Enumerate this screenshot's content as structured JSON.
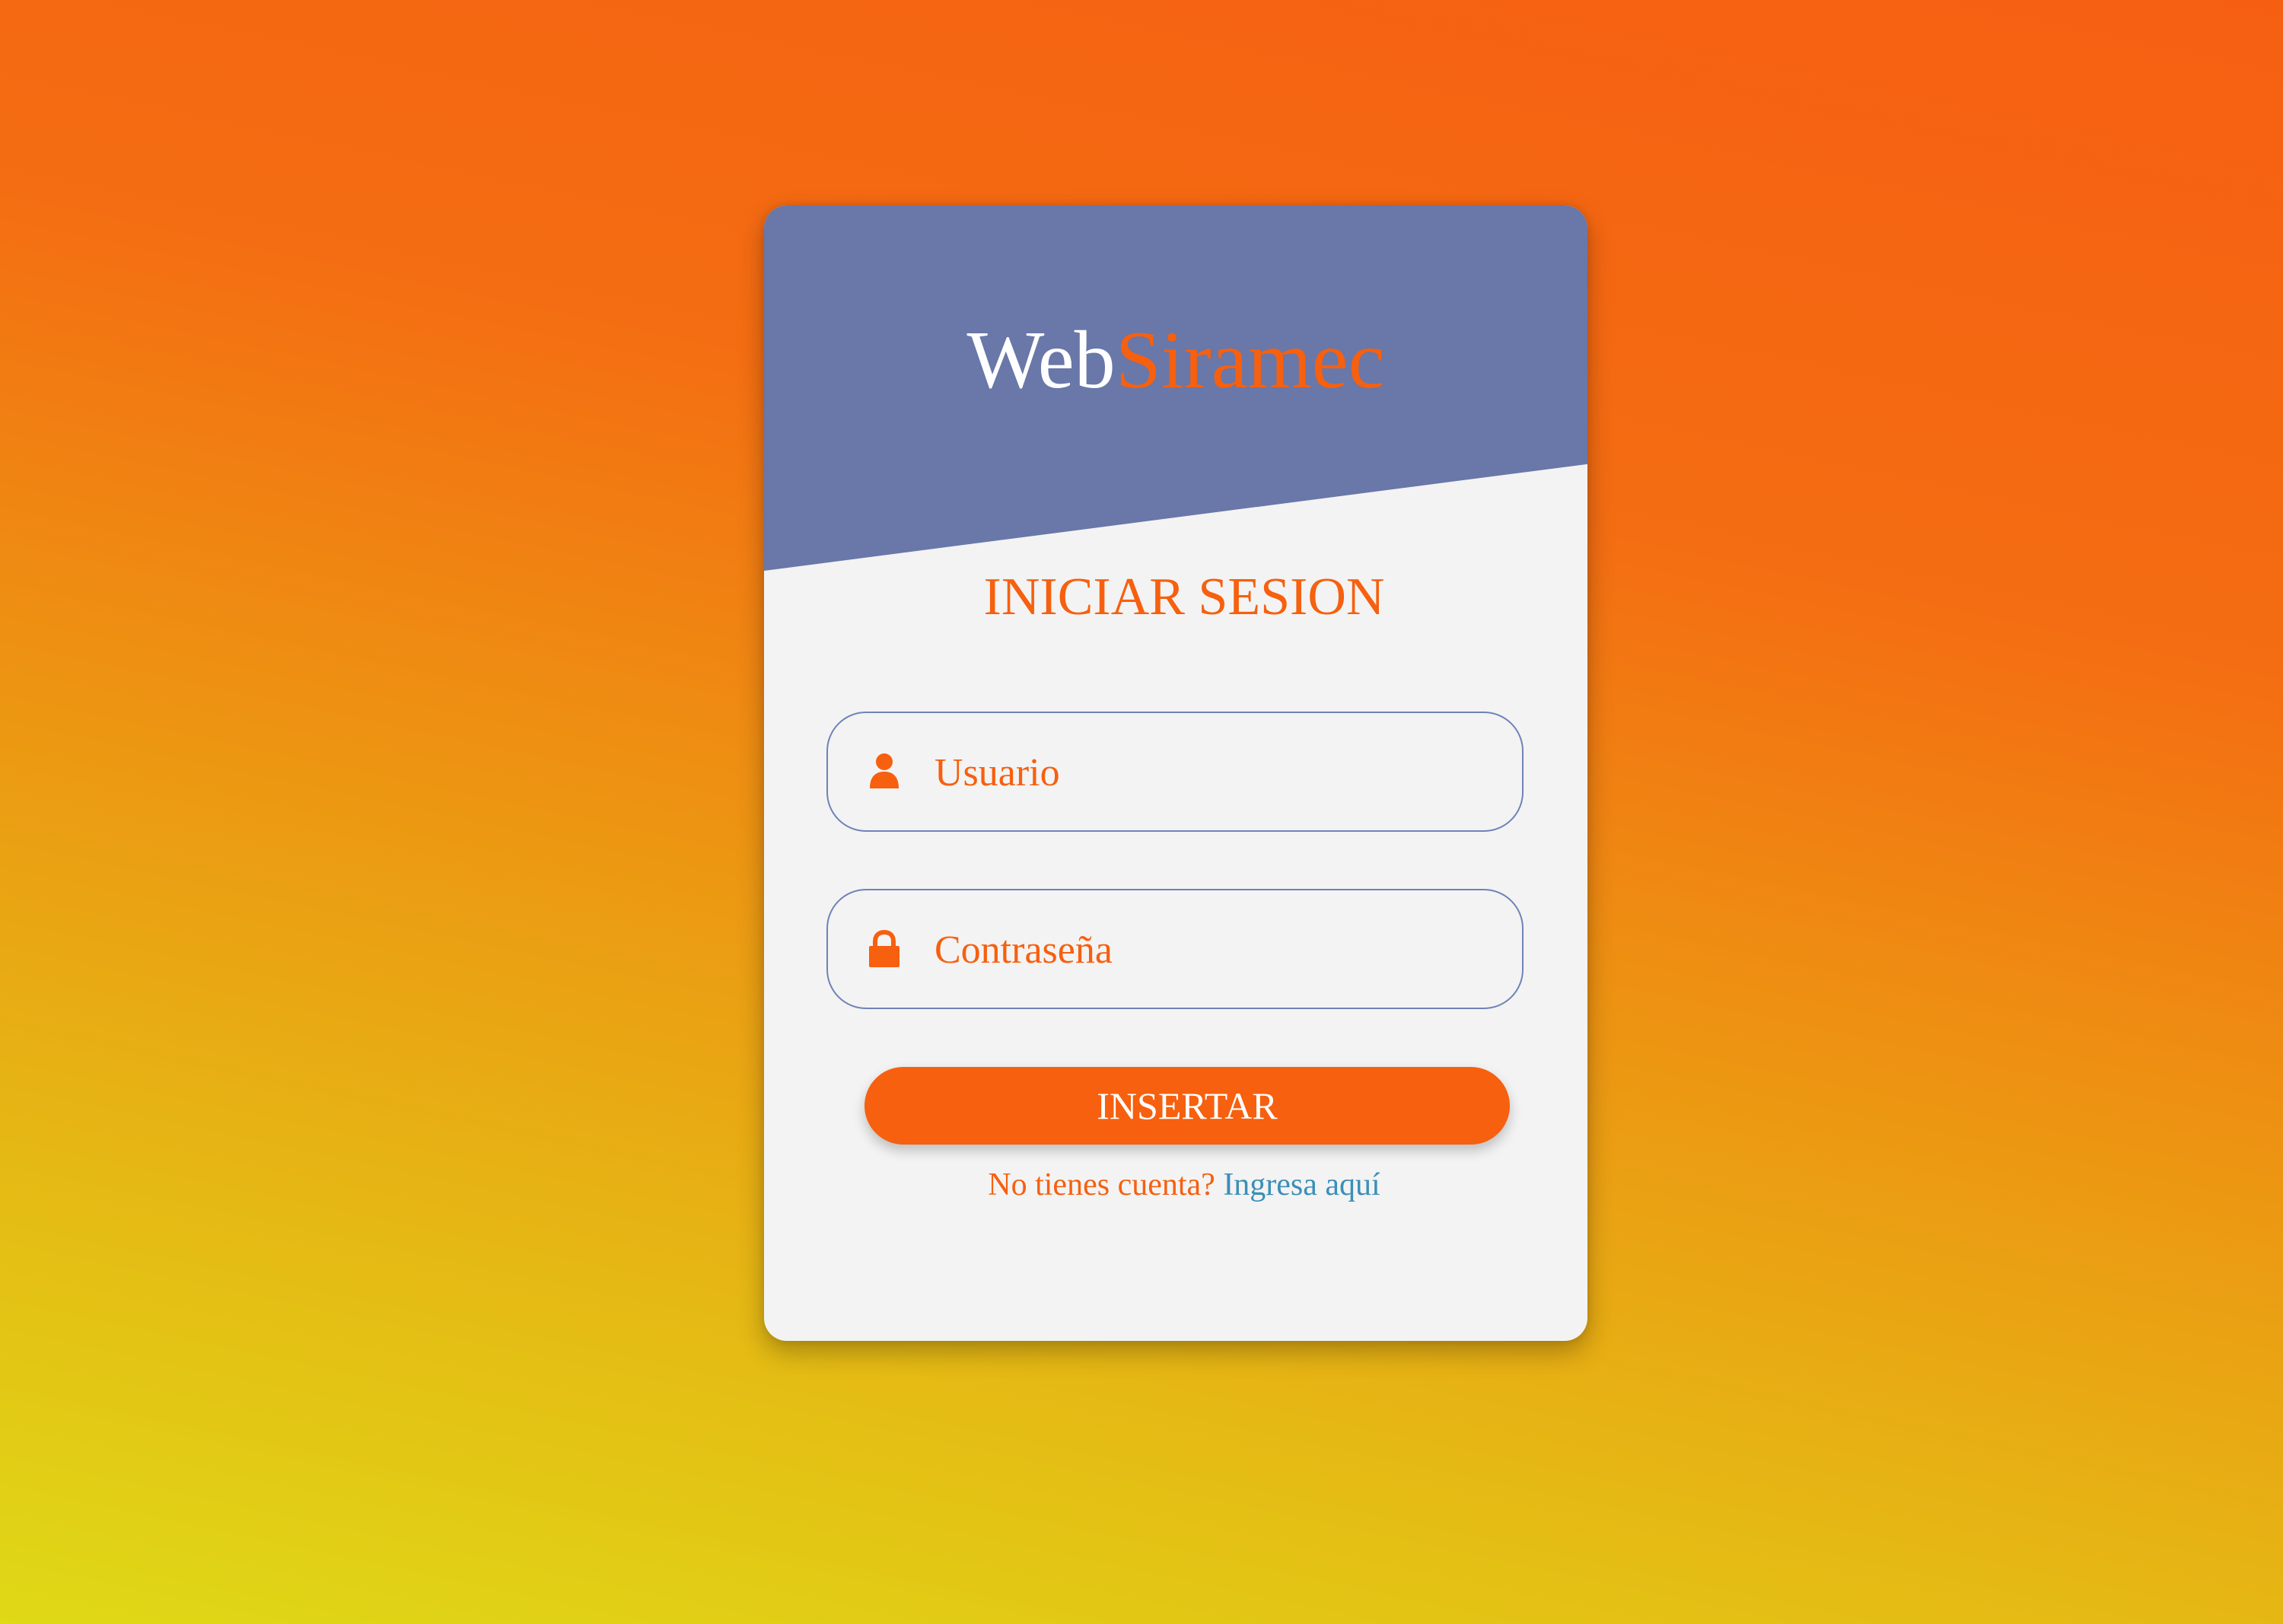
{
  "brand": {
    "part_1": "Web",
    "part_2": "Siramec"
  },
  "login": {
    "title": "INICIAR SESION",
    "username": {
      "placeholder": "Usuario",
      "icon": "user-icon"
    },
    "password": {
      "placeholder": "Contraseña",
      "icon": "lock-icon"
    },
    "submit_label": "INSERTAR",
    "signup_question": "No tienes cuenta?",
    "signup_link": "Ingresa aquí"
  },
  "colors": {
    "accent": "#f6600f",
    "header": "#6977a9",
    "card": "#f3f3f3",
    "link": "#3b8fb8"
  }
}
